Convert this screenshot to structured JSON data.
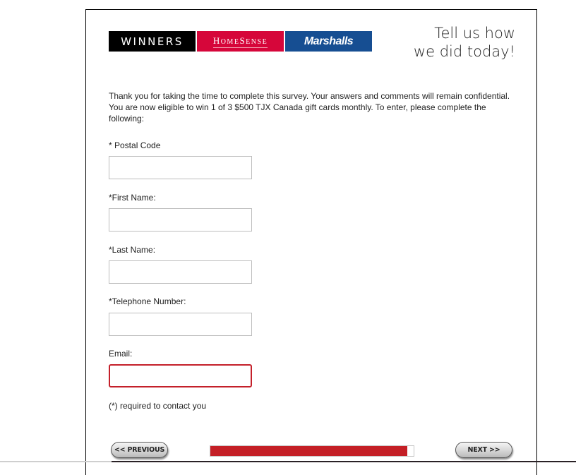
{
  "header": {
    "logos": {
      "winners": "WINNERS",
      "homesense_first": "H",
      "homesense_rest": "OME",
      "homesense_second": "S",
      "homesense_rest2": "ENSE",
      "marshalls": "Marshalls"
    },
    "tagline_line1": "Tell us how",
    "tagline_line2": "we did today!"
  },
  "intro": "Thank you for taking the time to complete this survey. Your answers and comments will remain confidential. You are now eligible to win 1 of 3 $500 TJX Canada gift cards monthly. To enter, please complete the following:",
  "form": {
    "postal_code": {
      "label": "* Postal Code",
      "value": ""
    },
    "first_name": {
      "label": "*First Name:",
      "value": ""
    },
    "last_name": {
      "label": "*Last Name:",
      "value": ""
    },
    "telephone": {
      "label": "*Telephone Number:",
      "value": ""
    },
    "email": {
      "label": "Email:",
      "value": ""
    },
    "required_note": "(*) required to contact you"
  },
  "navigation": {
    "previous_label": "<< PREVIOUS",
    "next_label": "NEXT >>",
    "progress_percent": 97,
    "progress_color": "#c41f26"
  },
  "colors": {
    "winners": "#000000",
    "homesense": "#d6063a",
    "marshalls": "#164e92",
    "focus_border": "#c4202a"
  }
}
